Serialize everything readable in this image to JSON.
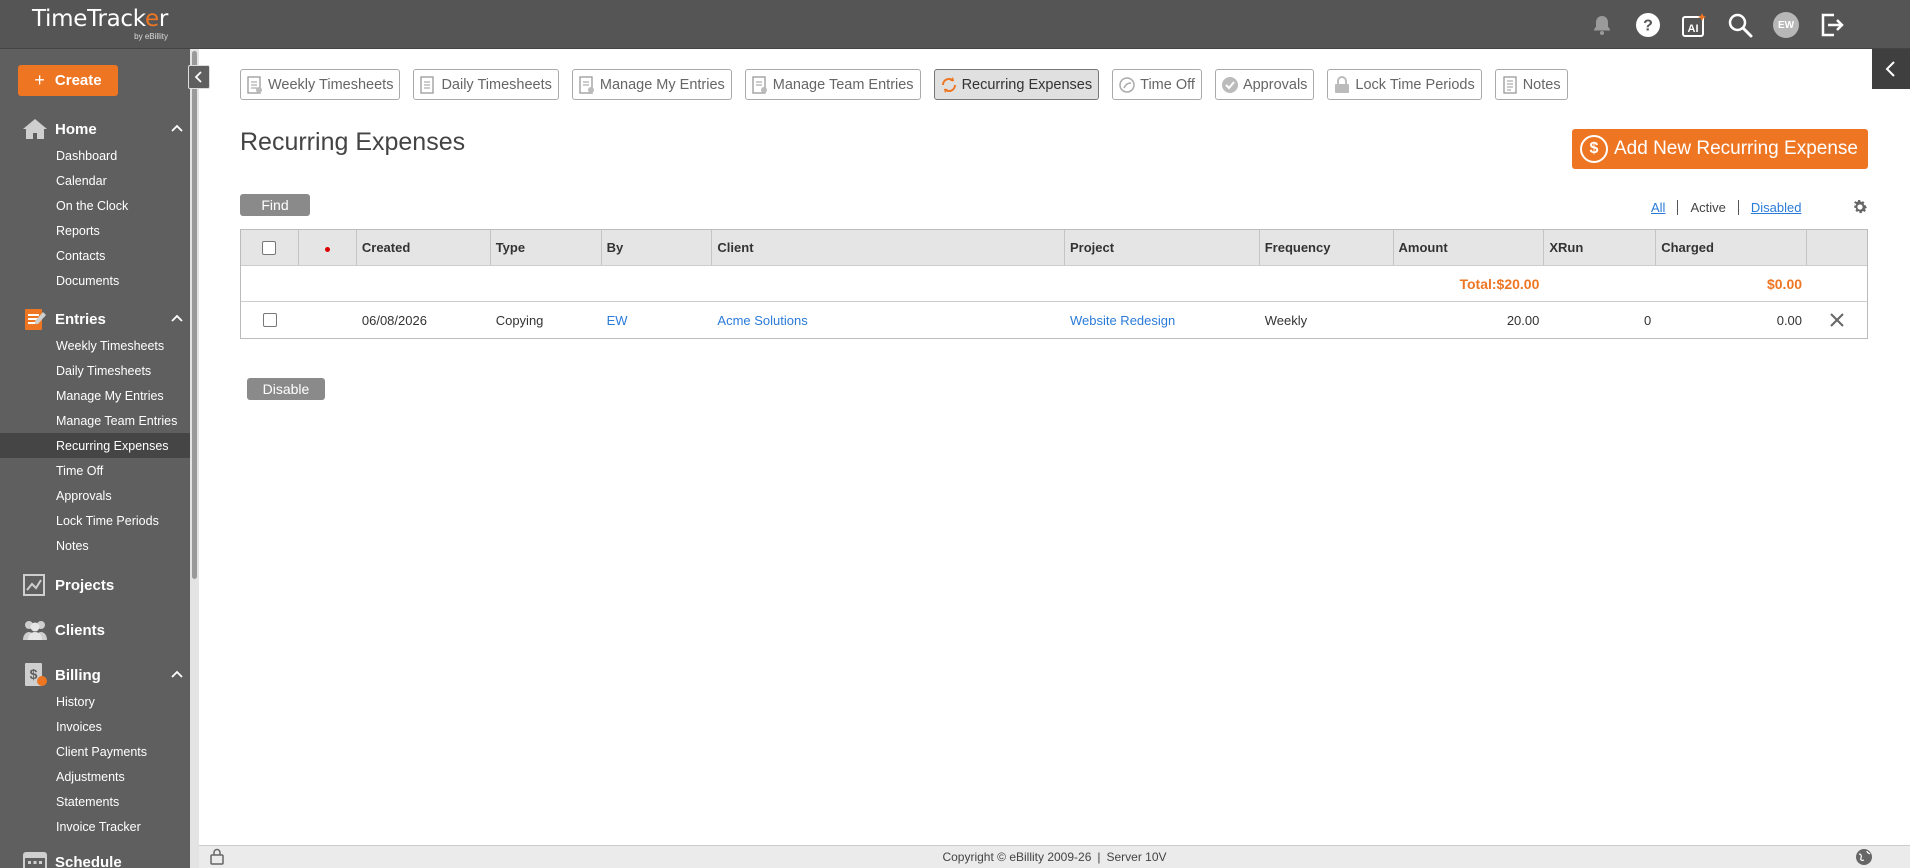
{
  "app": {
    "logo_text_a": "TimeTrack",
    "logo_text_o": "e",
    "logo_text_b": "r",
    "logo_sub": "by eBillity"
  },
  "topbar": {
    "avatar_initials": "EW"
  },
  "sidebar": {
    "create_label": "Create",
    "sections": {
      "home": {
        "label": "Home",
        "items": [
          "Dashboard",
          "Calendar",
          "On the Clock",
          "Reports",
          "Contacts",
          "Documents"
        ]
      },
      "entries": {
        "label": "Entries",
        "items": [
          "Weekly Timesheets",
          "Daily Timesheets",
          "Manage My Entries",
          "Manage Team Entries",
          "Recurring Expenses",
          "Time Off",
          "Approvals",
          "Lock Time Periods",
          "Notes"
        ],
        "active_item": "Recurring Expenses"
      },
      "projects": {
        "label": "Projects"
      },
      "clients": {
        "label": "Clients"
      },
      "billing": {
        "label": "Billing",
        "items": [
          "History",
          "Invoices",
          "Client Payments",
          "Adjustments",
          "Statements",
          "Invoice Tracker"
        ]
      },
      "schedule": {
        "label": "Schedule"
      }
    }
  },
  "tabs": [
    {
      "label": "Weekly Timesheets",
      "icon": "timesheet-icon"
    },
    {
      "label": "Daily Timesheets",
      "icon": "timesheet-icon"
    },
    {
      "label": "Manage My Entries",
      "icon": "entries-icon"
    },
    {
      "label": "Manage Team Entries",
      "icon": "entries-icon"
    },
    {
      "label": "Recurring Expenses",
      "icon": "recurring-icon",
      "active": true
    },
    {
      "label": "Time Off",
      "icon": "time-off-icon"
    },
    {
      "label": "Approvals",
      "icon": "approval-icon"
    },
    {
      "label": "Lock Time Periods",
      "icon": "lock-icon"
    },
    {
      "label": "Notes",
      "icon": "notes-icon"
    }
  ],
  "page": {
    "title": "Recurring Expenses",
    "add_button": "Add New Recurring Expense",
    "find_button": "Find",
    "disable_button": "Disable",
    "filters": {
      "all": "All",
      "active": "Active",
      "disabled": "Disabled"
    }
  },
  "table": {
    "headers": [
      "Created",
      "Type",
      "By",
      "Client",
      "Project",
      "Frequency",
      "Amount",
      "XRun",
      "Charged"
    ],
    "totals": {
      "amount": "Total:$20.00",
      "charged": "$0.00"
    },
    "rows": [
      {
        "created": "06/08/2026",
        "type": "Copying",
        "by": "EW",
        "client": "Acme Solutions",
        "project": "Website Redesign",
        "frequency": "Weekly",
        "amount": "20.00",
        "xrun": "0",
        "charged": "0.00"
      }
    ]
  },
  "footer": {
    "copyright": "Copyright © eBillity 2009-26",
    "separator": "|",
    "server": "Server 10V"
  },
  "colors": {
    "accent": "#ee7623",
    "topbar": "#555555",
    "sidebar": "#5f5f5f",
    "link": "#2a7bd8"
  }
}
